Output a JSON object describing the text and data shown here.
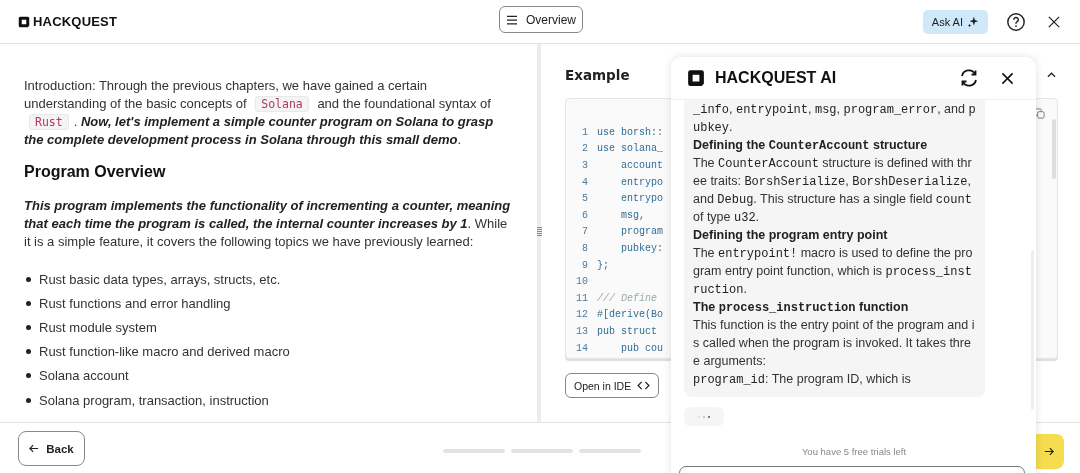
{
  "header": {
    "brand": "HACKQUEST",
    "overview_button": "Overview",
    "ask_ai_button": "Ask AI"
  },
  "lesson": {
    "intro": [
      {
        "kind": "text",
        "text": "Introduction: Through the previous chapters, we have gained a certain understanding of the basic concepts of "
      },
      {
        "kind": "code",
        "text": "Solana"
      },
      {
        "kind": "text",
        "text": " and the foundational syntax of "
      },
      {
        "kind": "code",
        "text": "Rust"
      },
      {
        "kind": "text",
        "text": ". "
      },
      {
        "kind": "emph",
        "text": "Now, let's implement a simple counter program on Solana to grasp the complete development process in Solana through this small demo"
      },
      {
        "kind": "text",
        "text": "."
      }
    ],
    "heading": "Program Overview",
    "summary": [
      {
        "kind": "emph",
        "text": "This program implements the functionality of incrementing a counter, meaning that each time the program is called, the internal counter increases by 1"
      },
      {
        "kind": "text",
        "text": ". While it is a simple feature, it covers the following topics we have previously learned:"
      }
    ],
    "topics": [
      "Rust basic data types, arrays, structs, etc.",
      "Rust functions and error handling",
      "Rust module system",
      "Rust function-like macro and derived macro",
      "Solana account",
      "Solana program, transaction, instruction"
    ]
  },
  "example": {
    "title": "Example",
    "code_lines": [
      {
        "number": "1",
        "kind": "code",
        "text": "use borsh::"
      },
      {
        "number": "2",
        "kind": "code",
        "text": "use solana_"
      },
      {
        "number": "3",
        "kind": "code",
        "text": "    account"
      },
      {
        "number": "4",
        "kind": "code",
        "text": "    entrypo"
      },
      {
        "number": "5",
        "kind": "code",
        "text": "    entrypo"
      },
      {
        "number": "6",
        "kind": "code",
        "text": "    msg,"
      },
      {
        "number": "7",
        "kind": "code",
        "text": "    program"
      },
      {
        "number": "8",
        "kind": "code",
        "text": "    pubkey:"
      },
      {
        "number": "9",
        "kind": "code",
        "text": "};"
      },
      {
        "number": "10"
      },
      {
        "number": "11",
        "kind": "comment",
        "text": "/// Define"
      },
      {
        "number": "12",
        "kind": "code",
        "text": "#[derive(Bo"
      },
      {
        "number": "13",
        "kind": "code",
        "text": "pub struct"
      },
      {
        "number": "14",
        "kind": "code",
        "text": "    pub cou"
      }
    ],
    "open_ide_button": "Open in IDE"
  },
  "footer": {
    "back_button": "Back"
  },
  "assistant": {
    "title": "HACKQUEST AI",
    "message": [
      {
        "kind": "body",
        "segments": [
          {
            "kind": "code",
            "text": "_info"
          },
          {
            "kind": "text",
            "text": ", "
          },
          {
            "kind": "code",
            "text": "entrypoint"
          },
          {
            "kind": "text",
            "text": ", "
          },
          {
            "kind": "code",
            "text": "msg"
          },
          {
            "kind": "text",
            "text": ", "
          },
          {
            "kind": "code",
            "text": "program_error"
          },
          {
            "kind": "text",
            "text": ", and "
          },
          {
            "kind": "code",
            "text": "pubkey"
          },
          {
            "kind": "text",
            "text": "."
          }
        ]
      },
      {
        "kind": "heading",
        "segments": [
          {
            "kind": "text",
            "text": "Defining the "
          },
          {
            "kind": "code",
            "text": "CounterAccount"
          },
          {
            "kind": "text",
            "text": " structure"
          }
        ]
      },
      {
        "kind": "body",
        "segments": [
          {
            "kind": "text",
            "text": "The "
          },
          {
            "kind": "code",
            "text": "CounterAccount"
          },
          {
            "kind": "text",
            "text": " structure is defined with three traits: "
          },
          {
            "kind": "code",
            "text": "BorshSerialize"
          },
          {
            "kind": "text",
            "text": ", "
          },
          {
            "kind": "code",
            "text": "BorshDeserialize"
          },
          {
            "kind": "text",
            "text": ", and "
          },
          {
            "kind": "code",
            "text": "Debug"
          },
          {
            "kind": "text",
            "text": ". This structure has a single field "
          },
          {
            "kind": "code",
            "text": "count"
          },
          {
            "kind": "text",
            "text": " of type "
          },
          {
            "kind": "code",
            "text": "u32"
          },
          {
            "kind": "text",
            "text": "."
          }
        ]
      },
      {
        "kind": "heading",
        "segments": [
          {
            "kind": "text",
            "text": "Defining the program entry point"
          }
        ]
      },
      {
        "kind": "body",
        "segments": [
          {
            "kind": "text",
            "text": "The "
          },
          {
            "kind": "code",
            "text": "entrypoint!"
          },
          {
            "kind": "text",
            "text": " macro is used to define the program entry point function, which is "
          },
          {
            "kind": "code",
            "text": "process_instruction"
          },
          {
            "kind": "text",
            "text": "."
          }
        ]
      },
      {
        "kind": "heading",
        "segments": [
          {
            "kind": "text",
            "text": "The "
          },
          {
            "kind": "code",
            "text": "process_instruction"
          },
          {
            "kind": "text",
            "text": " function"
          }
        ]
      },
      {
        "kind": "body",
        "segments": [
          {
            "kind": "text",
            "text": "This function is the entry point of the program and is called when the program is invoked. It takes three arguments:"
          }
        ]
      },
      {
        "kind": "body",
        "segments": [
          {
            "kind": "code",
            "text": "program_id"
          },
          {
            "kind": "text",
            "text": ": The program ID, which is"
          }
        ]
      }
    ],
    "trials_note": "You have 5 free trials left"
  }
}
